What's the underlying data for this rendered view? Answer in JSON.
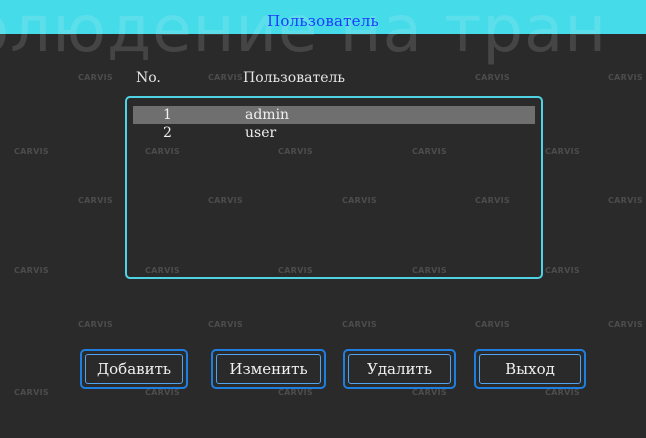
{
  "ghost_banner": "олюдение на тран",
  "window": {
    "title": "Пользователь"
  },
  "watermark": {
    "text": "CARVIS"
  },
  "user_list": {
    "columns": [
      "No.",
      "Пользователь"
    ],
    "rows": [
      {
        "no": "1",
        "name": "admin",
        "selected": true
      },
      {
        "no": "2",
        "name": "user",
        "selected": false
      }
    ]
  },
  "buttons": {
    "add": "Добавить",
    "edit": "Изменить",
    "delete": "Удалить",
    "exit": "Выход"
  },
  "colors": {
    "title_bar": "#46dbe9",
    "title_text": "#1b3cff",
    "background": "#2a2a2a",
    "list_border": "#4fd2e4",
    "selected_row": "#6f6f6f",
    "button_border": "#1f7fe0"
  }
}
